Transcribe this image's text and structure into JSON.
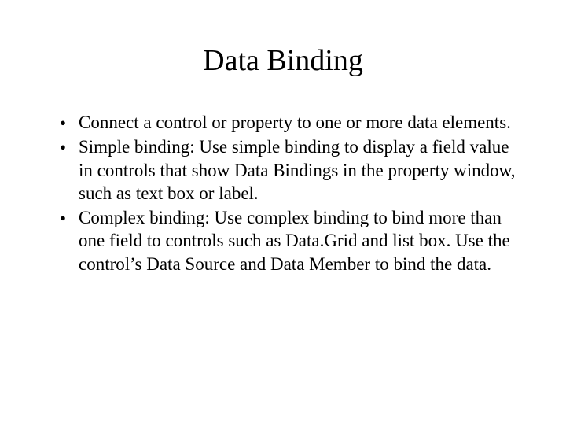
{
  "slide": {
    "title": "Data Binding",
    "bullets": [
      "Connect a control or property to one or more data elements.",
      "Simple binding: Use simple binding to display a field value in controls that show Data Bindings in the property window, such as text box or label.",
      "Complex binding: Use complex binding to bind more than one field to controls such as Data.Grid and list box.  Use the control’s Data Source and Data Member to bind the data."
    ]
  }
}
